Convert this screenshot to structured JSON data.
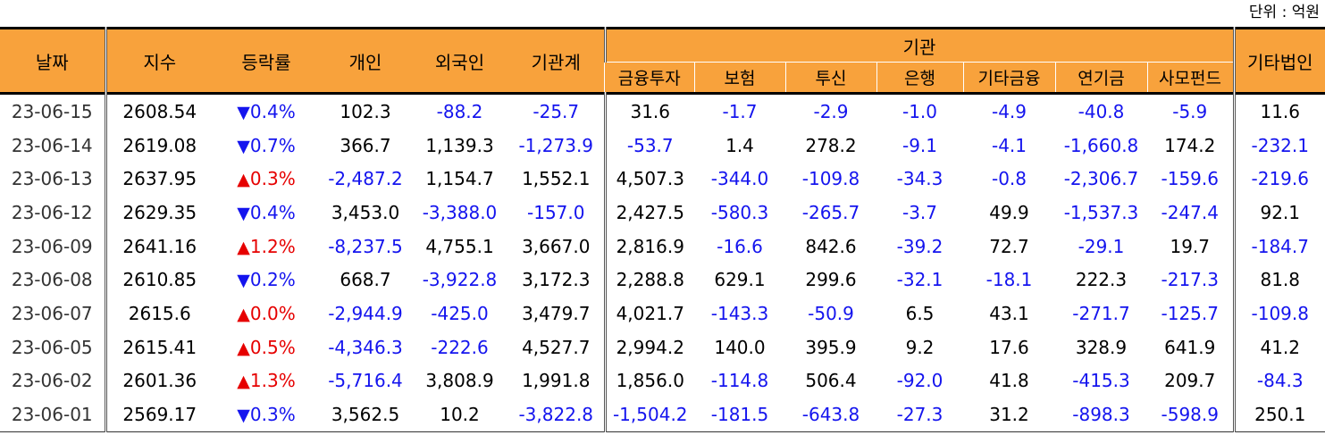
{
  "unit_label": "단위 : 억원",
  "headers": {
    "date": "날짜",
    "index": "지수",
    "change": "등락률",
    "individual": "개인",
    "foreign": "외국인",
    "inst_total": "기관계",
    "inst_group": "기관",
    "inst_sub": [
      "금융투자",
      "보험",
      "투신",
      "은행",
      "기타금융",
      "연기금",
      "사모펀드"
    ],
    "other_corp": "기타법인"
  },
  "rows": [
    {
      "date": "23-06-15",
      "index": "2608.54",
      "dir": "down",
      "rate": "0.4%",
      "values": [
        "102.3",
        "-88.2",
        "-25.7",
        "31.6",
        "-1.7",
        "-2.9",
        "-1.0",
        "-4.9",
        "-40.8",
        "-5.9",
        "11.6"
      ]
    },
    {
      "date": "23-06-14",
      "index": "2619.08",
      "dir": "down",
      "rate": "0.7%",
      "values": [
        "366.7",
        "1,139.3",
        "-1,273.9",
        "-53.7",
        "1.4",
        "278.2",
        "-9.1",
        "-4.1",
        "-1,660.8",
        "174.2",
        "-232.1"
      ]
    },
    {
      "date": "23-06-13",
      "index": "2637.95",
      "dir": "up",
      "rate": "0.3%",
      "values": [
        "-2,487.2",
        "1,154.7",
        "1,552.1",
        "4,507.3",
        "-344.0",
        "-109.8",
        "-34.3",
        "-0.8",
        "-2,306.7",
        "-159.6",
        "-219.6"
      ]
    },
    {
      "date": "23-06-12",
      "index": "2629.35",
      "dir": "down",
      "rate": "0.4%",
      "values": [
        "3,453.0",
        "-3,388.0",
        "-157.0",
        "2,427.5",
        "-580.3",
        "-265.7",
        "-3.7",
        "49.9",
        "-1,537.3",
        "-247.4",
        "92.1"
      ]
    },
    {
      "date": "23-06-09",
      "index": "2641.16",
      "dir": "up",
      "rate": "1.2%",
      "values": [
        "-8,237.5",
        "4,755.1",
        "3,667.0",
        "2,816.9",
        "-16.6",
        "842.6",
        "-39.2",
        "72.7",
        "-29.1",
        "19.7",
        "-184.7"
      ]
    },
    {
      "date": "23-06-08",
      "index": "2610.85",
      "dir": "down",
      "rate": "0.2%",
      "values": [
        "668.7",
        "-3,922.8",
        "3,172.3",
        "2,288.8",
        "629.1",
        "299.6",
        "-32.1",
        "-18.1",
        "222.3",
        "-217.3",
        "81.8"
      ]
    },
    {
      "date": "23-06-07",
      "index": "2615.6",
      "dir": "up",
      "rate": "0.0%",
      "values": [
        "-2,944.9",
        "-425.0",
        "3,479.7",
        "4,021.7",
        "-143.3",
        "-50.9",
        "6.5",
        "43.1",
        "-271.7",
        "-125.7",
        "-109.8"
      ]
    },
    {
      "date": "23-06-05",
      "index": "2615.41",
      "dir": "up",
      "rate": "0.5%",
      "values": [
        "-4,346.3",
        "-222.6",
        "4,527.7",
        "2,994.2",
        "140.0",
        "395.9",
        "9.2",
        "17.6",
        "328.9",
        "641.9",
        "41.2"
      ]
    },
    {
      "date": "23-06-02",
      "index": "2601.36",
      "dir": "up",
      "rate": "1.3%",
      "values": [
        "-5,716.4",
        "3,808.9",
        "1,991.8",
        "1,856.0",
        "-114.8",
        "506.4",
        "-92.0",
        "41.8",
        "-415.3",
        "209.7",
        "-84.3"
      ]
    },
    {
      "date": "23-06-01",
      "index": "2569.17",
      "dir": "down",
      "rate": "0.3%",
      "values": [
        "3,562.5",
        "10.2",
        "-3,822.8",
        "-1,504.2",
        "-181.5",
        "-643.8",
        "-27.3",
        "31.2",
        "-898.3",
        "-598.9",
        "250.1"
      ]
    }
  ],
  "colors": {
    "header_bg": "#f8a23c",
    "negative": "#1414ee",
    "up": "#e60000",
    "down": "#1414ee"
  },
  "icons": {
    "up": "triangle-up-icon",
    "down": "triangle-down-icon"
  }
}
